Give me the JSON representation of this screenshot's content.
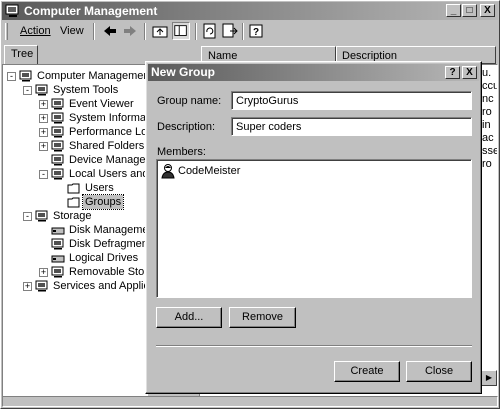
{
  "main_window": {
    "title": "Computer Management",
    "menu": [
      "Action",
      "View"
    ],
    "tree_tab": "Tree",
    "columns": [
      "Name",
      "Description"
    ],
    "right_pane_fragments": [
      "u.",
      "ccu",
      "nc",
      "ro",
      "in",
      "ac",
      "sse",
      "ro"
    ]
  },
  "tree": [
    {
      "label": "Computer Management (Loc",
      "icon": "computer-icon"
    },
    {
      "label": "System Tools",
      "icon": "tools-icon"
    },
    {
      "label": "Event Viewer",
      "icon": "event-viewer-icon"
    },
    {
      "label": "System Information",
      "icon": "system-info-icon"
    },
    {
      "label": "Performance Logs an",
      "icon": "performance-icon"
    },
    {
      "label": "Shared Folders",
      "icon": "shared-folder-icon"
    },
    {
      "label": "Device Manager",
      "icon": "device-manager-icon"
    },
    {
      "label": "Local Users and Grou",
      "icon": "users-groups-icon"
    },
    {
      "label": "Users",
      "icon": "folder-icon"
    },
    {
      "label": "Groups",
      "icon": "folder-icon"
    },
    {
      "label": "Storage",
      "icon": "storage-icon"
    },
    {
      "label": "Disk Management",
      "icon": "disk-icon"
    },
    {
      "label": "Disk Defragmenter",
      "icon": "defrag-icon"
    },
    {
      "label": "Logical Drives",
      "icon": "drive-icon"
    },
    {
      "label": "Removable Storage",
      "icon": "removable-storage-icon"
    },
    {
      "label": "Services and Applications",
      "icon": "services-icon"
    }
  ],
  "dialog": {
    "title": "New Group",
    "group_name_label": "Group name:",
    "group_name_value": "CryptoGurus",
    "description_label": "Description:",
    "description_value": "Super coders",
    "members_label": "Members:",
    "members": [
      "CodeMeister"
    ],
    "add_label": "Add...",
    "remove_label": "Remove",
    "create_label": "Create",
    "close_label": "Close",
    "help_glyph": "?",
    "close_glyph": "X"
  },
  "window_controls": {
    "minimize": "_",
    "maximize": "□",
    "close": "X"
  }
}
